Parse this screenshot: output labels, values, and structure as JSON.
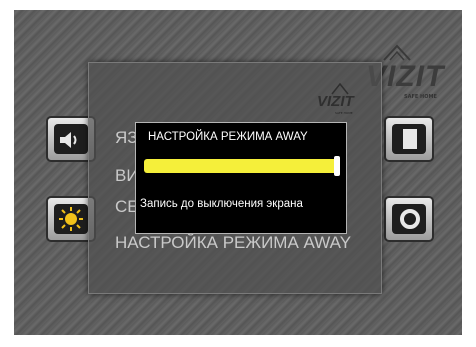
{
  "brand": {
    "name": "VIZIT",
    "tagline": "SAFE HOME"
  },
  "menu": {
    "items": [
      "ЯЗ",
      "ВИ",
      "СЕ",
      "НАСТРОЙКА РЕЖИМА AWAY"
    ]
  },
  "dialog": {
    "title": "НАСТРОЙКА РЕЖИМА AWAY",
    "progress": 1.0,
    "status": "Запись до выключения экрана",
    "bar_color": "#f5ef3a"
  },
  "tiles": [
    {
      "icon": "speaker-icon"
    },
    {
      "icon": "brightness-icon"
    },
    {
      "icon": "document-icon"
    },
    {
      "icon": "settings-gear-icon"
    }
  ]
}
